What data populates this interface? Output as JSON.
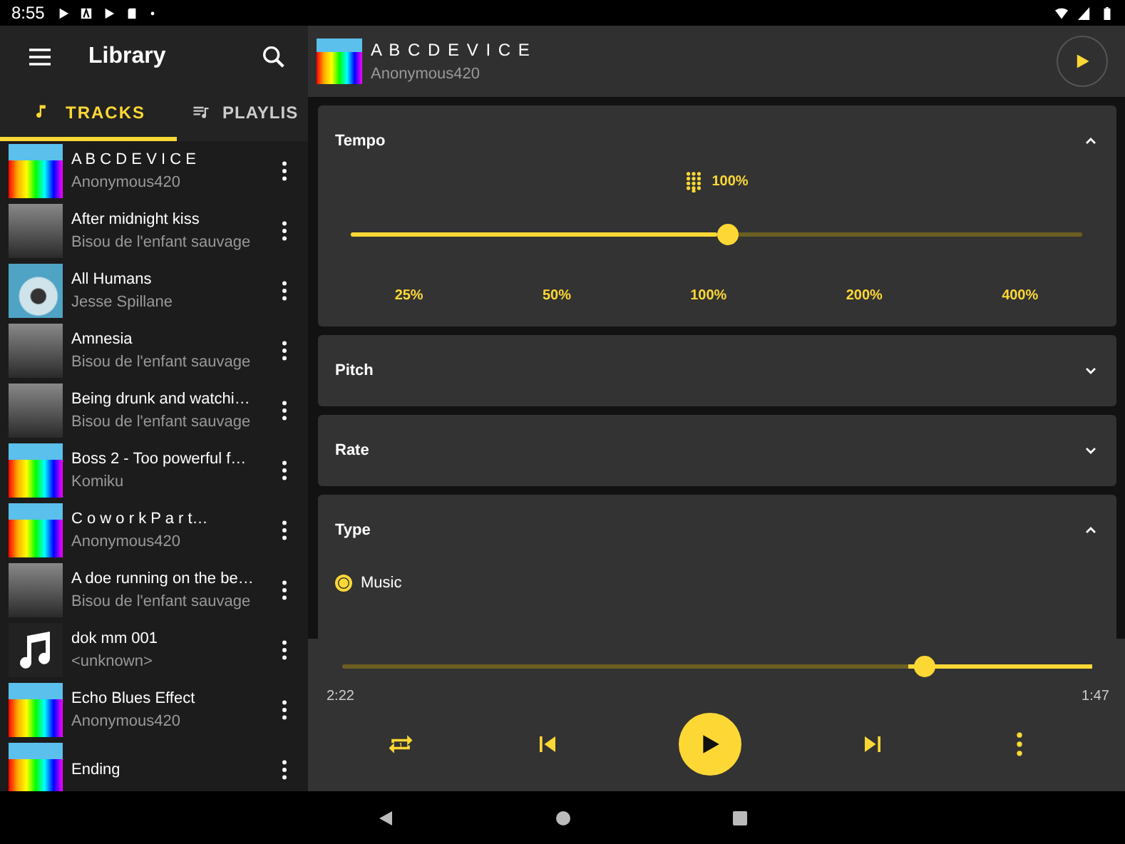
{
  "status_bar": {
    "time": "8:55"
  },
  "app_bar": {
    "title": "Library"
  },
  "tabs": [
    {
      "label": "TRACKS",
      "kind": "tracks",
      "selected": true
    },
    {
      "label": "PLAYLIS",
      "kind": "playlists",
      "selected": false
    }
  ],
  "tracks": [
    {
      "title": "A B C D E V I C E",
      "artist": "Anonymous420",
      "kind": "colorful"
    },
    {
      "title": "After midnight kiss",
      "artist": "Bisou de l'enfant sauvage",
      "kind": "photo"
    },
    {
      "title": "All Humans",
      "artist": "Jesse Spillane",
      "kind": "cover"
    },
    {
      "title": "Amnesia",
      "artist": "Bisou de l'enfant sauvage",
      "kind": "photo"
    },
    {
      "title": "Being drunk and watchi…",
      "artist": "Bisou de l'enfant sauvage",
      "kind": "photo"
    },
    {
      "title": "Boss 2 - Too powerful f…",
      "artist": "Komiku",
      "kind": "colorful"
    },
    {
      "title": "C o w o r k  P a r t…",
      "artist": "Anonymous420",
      "kind": "colorful"
    },
    {
      "title": "A doe running on the be…",
      "artist": "Bisou de l'enfant sauvage",
      "kind": "photo"
    },
    {
      "title": "dok mm 001",
      "artist": "<unknown>",
      "kind": "note"
    },
    {
      "title": "Echo Blues Effect",
      "artist": "Anonymous420",
      "kind": "colorful"
    },
    {
      "title": "Ending",
      "kind": "colorful"
    }
  ],
  "now_playing": {
    "title": "A B C D E V I C E",
    "artist": "Anonymous420"
  },
  "tempo": {
    "title": "Tempo",
    "expanded": true,
    "reading": "100%",
    "level": 0.5,
    "marks": [
      "25%",
      "50%",
      "100%",
      "200%",
      "400%"
    ]
  },
  "pitch": {
    "title": "Pitch",
    "expanded": false
  },
  "rate": {
    "title": "Rate",
    "expanded": false
  },
  "type": {
    "title": "Type",
    "expanded": true,
    "options": [
      {
        "label": "Music",
        "selected": true
      }
    ]
  },
  "player": {
    "level": 0.755,
    "elapsed": "2:22",
    "remaining": "1:47"
  }
}
